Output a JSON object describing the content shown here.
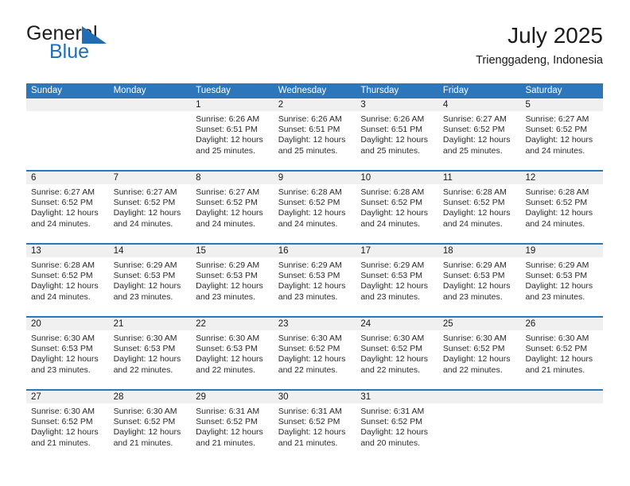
{
  "brand": {
    "name_top": "General",
    "name_bottom": "Blue",
    "triangle_icon": "triangle-icon",
    "color_blue": "#1f6eb5",
    "color_dark": "#1c1c1c"
  },
  "header": {
    "title": "July 2025",
    "subtitle": "Trienggadeng, Indonesia"
  },
  "theme": {
    "header_blue": "#2e76ba",
    "band_gray": "#f0f0f0",
    "text_dark": "#1a1a1a"
  },
  "weekdays": [
    "Sunday",
    "Monday",
    "Tuesday",
    "Wednesday",
    "Thursday",
    "Friday",
    "Saturday"
  ],
  "weeks": [
    [
      {
        "day": "",
        "lines": []
      },
      {
        "day": "",
        "lines": []
      },
      {
        "day": "1",
        "lines": [
          "Sunrise: 6:26 AM",
          "Sunset: 6:51 PM",
          "Daylight: 12 hours",
          "and 25 minutes."
        ]
      },
      {
        "day": "2",
        "lines": [
          "Sunrise: 6:26 AM",
          "Sunset: 6:51 PM",
          "Daylight: 12 hours",
          "and 25 minutes."
        ]
      },
      {
        "day": "3",
        "lines": [
          "Sunrise: 6:26 AM",
          "Sunset: 6:51 PM",
          "Daylight: 12 hours",
          "and 25 minutes."
        ]
      },
      {
        "day": "4",
        "lines": [
          "Sunrise: 6:27 AM",
          "Sunset: 6:52 PM",
          "Daylight: 12 hours",
          "and 25 minutes."
        ]
      },
      {
        "day": "5",
        "lines": [
          "Sunrise: 6:27 AM",
          "Sunset: 6:52 PM",
          "Daylight: 12 hours",
          "and 24 minutes."
        ]
      }
    ],
    [
      {
        "day": "6",
        "lines": [
          "Sunrise: 6:27 AM",
          "Sunset: 6:52 PM",
          "Daylight: 12 hours",
          "and 24 minutes."
        ]
      },
      {
        "day": "7",
        "lines": [
          "Sunrise: 6:27 AM",
          "Sunset: 6:52 PM",
          "Daylight: 12 hours",
          "and 24 minutes."
        ]
      },
      {
        "day": "8",
        "lines": [
          "Sunrise: 6:27 AM",
          "Sunset: 6:52 PM",
          "Daylight: 12 hours",
          "and 24 minutes."
        ]
      },
      {
        "day": "9",
        "lines": [
          "Sunrise: 6:28 AM",
          "Sunset: 6:52 PM",
          "Daylight: 12 hours",
          "and 24 minutes."
        ]
      },
      {
        "day": "10",
        "lines": [
          "Sunrise: 6:28 AM",
          "Sunset: 6:52 PM",
          "Daylight: 12 hours",
          "and 24 minutes."
        ]
      },
      {
        "day": "11",
        "lines": [
          "Sunrise: 6:28 AM",
          "Sunset: 6:52 PM",
          "Daylight: 12 hours",
          "and 24 minutes."
        ]
      },
      {
        "day": "12",
        "lines": [
          "Sunrise: 6:28 AM",
          "Sunset: 6:52 PM",
          "Daylight: 12 hours",
          "and 24 minutes."
        ]
      }
    ],
    [
      {
        "day": "13",
        "lines": [
          "Sunrise: 6:28 AM",
          "Sunset: 6:52 PM",
          "Daylight: 12 hours",
          "and 24 minutes."
        ]
      },
      {
        "day": "14",
        "lines": [
          "Sunrise: 6:29 AM",
          "Sunset: 6:53 PM",
          "Daylight: 12 hours",
          "and 23 minutes."
        ]
      },
      {
        "day": "15",
        "lines": [
          "Sunrise: 6:29 AM",
          "Sunset: 6:53 PM",
          "Daylight: 12 hours",
          "and 23 minutes."
        ]
      },
      {
        "day": "16",
        "lines": [
          "Sunrise: 6:29 AM",
          "Sunset: 6:53 PM",
          "Daylight: 12 hours",
          "and 23 minutes."
        ]
      },
      {
        "day": "17",
        "lines": [
          "Sunrise: 6:29 AM",
          "Sunset: 6:53 PM",
          "Daylight: 12 hours",
          "and 23 minutes."
        ]
      },
      {
        "day": "18",
        "lines": [
          "Sunrise: 6:29 AM",
          "Sunset: 6:53 PM",
          "Daylight: 12 hours",
          "and 23 minutes."
        ]
      },
      {
        "day": "19",
        "lines": [
          "Sunrise: 6:29 AM",
          "Sunset: 6:53 PM",
          "Daylight: 12 hours",
          "and 23 minutes."
        ]
      }
    ],
    [
      {
        "day": "20",
        "lines": [
          "Sunrise: 6:30 AM",
          "Sunset: 6:53 PM",
          "Daylight: 12 hours",
          "and 23 minutes."
        ]
      },
      {
        "day": "21",
        "lines": [
          "Sunrise: 6:30 AM",
          "Sunset: 6:53 PM",
          "Daylight: 12 hours",
          "and 22 minutes."
        ]
      },
      {
        "day": "22",
        "lines": [
          "Sunrise: 6:30 AM",
          "Sunset: 6:53 PM",
          "Daylight: 12 hours",
          "and 22 minutes."
        ]
      },
      {
        "day": "23",
        "lines": [
          "Sunrise: 6:30 AM",
          "Sunset: 6:52 PM",
          "Daylight: 12 hours",
          "and 22 minutes."
        ]
      },
      {
        "day": "24",
        "lines": [
          "Sunrise: 6:30 AM",
          "Sunset: 6:52 PM",
          "Daylight: 12 hours",
          "and 22 minutes."
        ]
      },
      {
        "day": "25",
        "lines": [
          "Sunrise: 6:30 AM",
          "Sunset: 6:52 PM",
          "Daylight: 12 hours",
          "and 22 minutes."
        ]
      },
      {
        "day": "26",
        "lines": [
          "Sunrise: 6:30 AM",
          "Sunset: 6:52 PM",
          "Daylight: 12 hours",
          "and 21 minutes."
        ]
      }
    ],
    [
      {
        "day": "27",
        "lines": [
          "Sunrise: 6:30 AM",
          "Sunset: 6:52 PM",
          "Daylight: 12 hours",
          "and 21 minutes."
        ]
      },
      {
        "day": "28",
        "lines": [
          "Sunrise: 6:30 AM",
          "Sunset: 6:52 PM",
          "Daylight: 12 hours",
          "and 21 minutes."
        ]
      },
      {
        "day": "29",
        "lines": [
          "Sunrise: 6:31 AM",
          "Sunset: 6:52 PM",
          "Daylight: 12 hours",
          "and 21 minutes."
        ]
      },
      {
        "day": "30",
        "lines": [
          "Sunrise: 6:31 AM",
          "Sunset: 6:52 PM",
          "Daylight: 12 hours",
          "and 21 minutes."
        ]
      },
      {
        "day": "31",
        "lines": [
          "Sunrise: 6:31 AM",
          "Sunset: 6:52 PM",
          "Daylight: 12 hours",
          "and 20 minutes."
        ]
      },
      {
        "day": "",
        "lines": []
      },
      {
        "day": "",
        "lines": []
      }
    ]
  ]
}
